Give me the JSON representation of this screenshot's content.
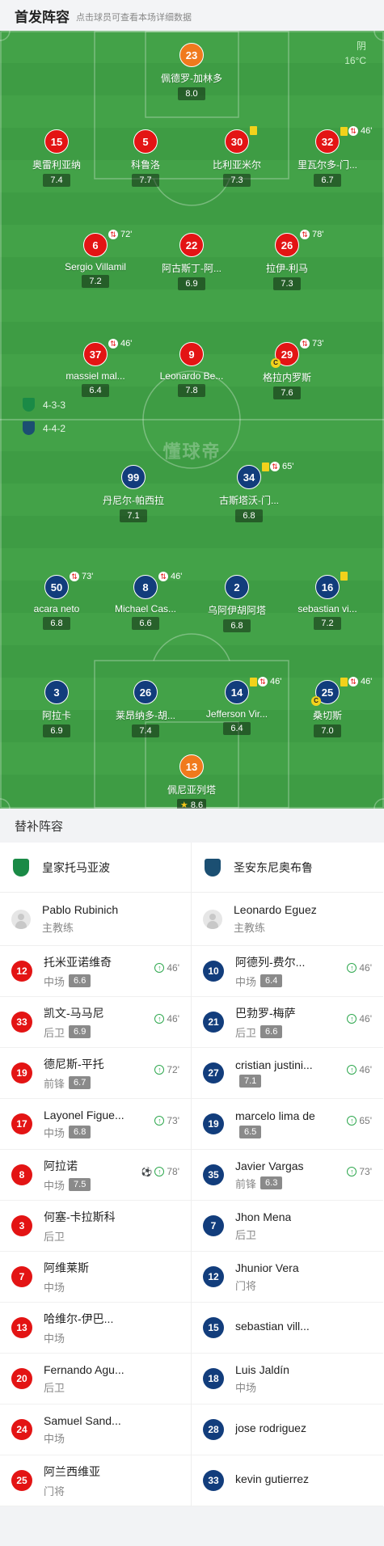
{
  "header": {
    "title": "首发阵容",
    "subtitle": "点击球员可查看本场详细数据"
  },
  "weather": {
    "condition": "阴",
    "temp": "16°C"
  },
  "watermark": "懂球帝",
  "formations": {
    "home": "4-3-3",
    "away": "4-4-2"
  },
  "home_players": [
    {
      "number": "23",
      "name": "佩德罗-加林多",
      "rating": "8.0",
      "color": "orange"
    },
    {
      "number": "15",
      "name": "奥雷利亚纳",
      "rating": "7.4",
      "color": "red"
    },
    {
      "number": "5",
      "name": "科鲁洛",
      "rating": "7.7",
      "color": "red"
    },
    {
      "number": "30",
      "name": "比利亚米尔",
      "rating": "7.3",
      "color": "red",
      "yellow": true,
      "goal": true
    },
    {
      "number": "32",
      "name": "里瓦尔多-门...",
      "rating": "6.7",
      "color": "red",
      "yellow": true,
      "sub_out": "46'"
    },
    {
      "number": "6",
      "name": "Sergio Villamil",
      "rating": "7.2",
      "color": "red",
      "sub_out": "72'"
    },
    {
      "number": "22",
      "name": "阿古斯丁-阿...",
      "rating": "6.9",
      "color": "red"
    },
    {
      "number": "26",
      "name": "拉伊-利马",
      "rating": "7.3",
      "color": "red",
      "sub_out": "78'"
    },
    {
      "number": "37",
      "name": "massiel mal...",
      "rating": "6.4",
      "color": "red",
      "sub_out": "46'"
    },
    {
      "number": "9",
      "name": "Leonardo Be...",
      "rating": "7.8",
      "color": "red"
    },
    {
      "number": "29",
      "name": "格拉内罗斯",
      "rating": "7.6",
      "color": "red",
      "captain": true,
      "sub_out": "73'"
    }
  ],
  "away_players": [
    {
      "number": "99",
      "name": "丹尼尔-帕西拉",
      "rating": "7.1",
      "color": "blue"
    },
    {
      "number": "34",
      "name": "古斯塔沃-门...",
      "rating": "6.8",
      "color": "blue",
      "yellow": true,
      "sub_out": "65'"
    },
    {
      "number": "50",
      "name": "acara neto",
      "rating": "6.8",
      "color": "blue",
      "sub_out": "73'"
    },
    {
      "number": "8",
      "name": "Michael Cas...",
      "rating": "6.6",
      "color": "blue",
      "sub_out": "46'"
    },
    {
      "number": "2",
      "name": "乌阿伊胡阿塔",
      "rating": "6.8",
      "color": "blue"
    },
    {
      "number": "16",
      "name": "sebastian vi...",
      "rating": "7.2",
      "color": "blue",
      "yellow": true
    },
    {
      "number": "3",
      "name": "阿拉卡",
      "rating": "6.9",
      "color": "blue"
    },
    {
      "number": "26",
      "name": "莱昂纳多-胡...",
      "rating": "7.4",
      "color": "blue"
    },
    {
      "number": "14",
      "name": "Jefferson Vir...",
      "rating": "6.4",
      "color": "blue",
      "yellow": true,
      "sub_out": "46'"
    },
    {
      "number": "25",
      "name": "桑切斯",
      "rating": "7.0",
      "color": "blue",
      "yellow": true,
      "captain": true,
      "sub_out": "46'"
    },
    {
      "number": "13",
      "name": "佩尼亚列塔",
      "rating": "8.6",
      "color": "orange",
      "star": true
    }
  ],
  "subs_title": "替补阵容",
  "home_team": {
    "name": "皇家托马亚波",
    "coach": "Pablo Rubinich",
    "coach_role": "主教练",
    "badge_color": "#1a8a46"
  },
  "away_team": {
    "name": "圣安东尼奥布鲁",
    "coach": "Leonardo Eguez",
    "coach_role": "主教练",
    "badge_color": "#1b4f72"
  },
  "home_subs": [
    {
      "number": "12",
      "name": "托米亚诺维奇",
      "pos": "中场",
      "rating": "6.6",
      "in": "46'"
    },
    {
      "number": "33",
      "name": "凯文-马马尼",
      "pos": "后卫",
      "rating": "6.9",
      "in": "46'"
    },
    {
      "number": "19",
      "name": "德尼斯-平托",
      "pos": "前锋",
      "rating": "6.7",
      "in": "72'"
    },
    {
      "number": "17",
      "name": "Layonel Figue...",
      "pos": "中场",
      "rating": "6.8",
      "in": "73'"
    },
    {
      "number": "8",
      "name": "阿拉诺",
      "pos": "中场",
      "rating": "7.5",
      "in": "78'",
      "goal": true
    },
    {
      "number": "3",
      "name": "何塞-卡拉斯科",
      "pos": "后卫"
    },
    {
      "number": "7",
      "name": "阿维莱斯",
      "pos": "中场"
    },
    {
      "number": "13",
      "name": "哈维尔-伊巴...",
      "pos": "中场"
    },
    {
      "number": "20",
      "name": "Fernando Agu...",
      "pos": "后卫"
    },
    {
      "number": "24",
      "name": "Samuel Sand...",
      "pos": "中场"
    },
    {
      "number": "25",
      "name": "阿兰西维亚",
      "pos": "门将"
    }
  ],
  "away_subs": [
    {
      "number": "10",
      "name": "阿德列-费尔...",
      "pos": "中场",
      "rating": "6.4",
      "in": "46'"
    },
    {
      "number": "21",
      "name": "巴勃罗-梅萨",
      "pos": "后卫",
      "rating": "6.6",
      "in": "46'"
    },
    {
      "number": "27",
      "name": "cristian justini...",
      "pos": "",
      "rating": "7.1",
      "in": "46'"
    },
    {
      "number": "19",
      "name": "marcelo lima de",
      "pos": "",
      "rating": "6.5",
      "in": "65'"
    },
    {
      "number": "35",
      "name": "Javier Vargas",
      "pos": "前锋",
      "rating": "6.3",
      "in": "73'"
    },
    {
      "number": "7",
      "name": "Jhon Mena",
      "pos": "后卫"
    },
    {
      "number": "12",
      "name": "Jhunior Vera",
      "pos": "门将"
    },
    {
      "number": "15",
      "name": "sebastian vill...",
      "pos": ""
    },
    {
      "number": "18",
      "name": "Luis Jaldín",
      "pos": "中场"
    },
    {
      "number": "28",
      "name": "jose rodriguez",
      "pos": ""
    },
    {
      "number": "33",
      "name": "kevin gutierrez",
      "pos": ""
    }
  ]
}
